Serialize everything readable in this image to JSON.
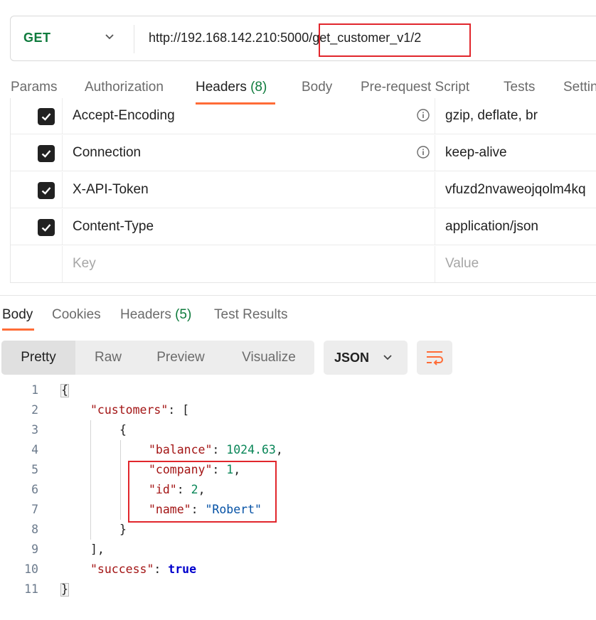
{
  "request": {
    "method": "GET",
    "url_host": "http://192.168.142.210:5000",
    "url_path": "/get_customer_v1/2"
  },
  "request_tabs": [
    {
      "label": "Params"
    },
    {
      "label": "Authorization"
    },
    {
      "label": "Headers",
      "count": "(8)",
      "active": true
    },
    {
      "label": "Body"
    },
    {
      "label": "Pre-request Script"
    },
    {
      "label": "Tests"
    },
    {
      "label": "Settin"
    }
  ],
  "headers": [
    {
      "key": "Accept-Encoding",
      "value": "gzip, deflate, br",
      "checked": true,
      "info": true
    },
    {
      "key": "Connection",
      "value": "keep-alive",
      "checked": true,
      "info": true
    },
    {
      "key": "X-API-Token",
      "value": "vfuzd2nvaweojqolm4kq",
      "checked": true,
      "info": false
    },
    {
      "key": "Content-Type",
      "value": "application/json",
      "checked": true,
      "info": false
    }
  ],
  "headers_placeholder": {
    "key": "Key",
    "value": "Value"
  },
  "response_tabs": [
    {
      "label": "Body",
      "active": true
    },
    {
      "label": "Cookies"
    },
    {
      "label": "Headers",
      "count": "(5)"
    },
    {
      "label": "Test Results"
    }
  ],
  "view_modes": [
    "Pretty",
    "Raw",
    "Preview",
    "Visualize"
  ],
  "active_view": "Pretty",
  "format": "JSON",
  "code_lines": [
    {
      "num": "1",
      "tokens": [
        {
          "t": "{",
          "c": "p"
        }
      ]
    },
    {
      "num": "2",
      "tokens": [
        {
          "t": "\"customers\"",
          "c": "k"
        },
        {
          "t": ": [",
          "c": "p"
        }
      ]
    },
    {
      "num": "3",
      "tokens": [
        {
          "t": "{",
          "c": "p"
        }
      ]
    },
    {
      "num": "4",
      "tokens": [
        {
          "t": "\"balance\"",
          "c": "k"
        },
        {
          "t": ": ",
          "c": "p"
        },
        {
          "t": "1024.63",
          "c": "n"
        },
        {
          "t": ",",
          "c": "p"
        }
      ]
    },
    {
      "num": "5",
      "tokens": [
        {
          "t": "\"company\"",
          "c": "k"
        },
        {
          "t": ": ",
          "c": "p"
        },
        {
          "t": "1",
          "c": "n"
        },
        {
          "t": ",",
          "c": "p"
        }
      ]
    },
    {
      "num": "6",
      "tokens": [
        {
          "t": "\"id\"",
          "c": "k"
        },
        {
          "t": ": ",
          "c": "p"
        },
        {
          "t": "2",
          "c": "n"
        },
        {
          "t": ",",
          "c": "p"
        }
      ]
    },
    {
      "num": "7",
      "tokens": [
        {
          "t": "\"name\"",
          "c": "k"
        },
        {
          "t": ": ",
          "c": "p"
        },
        {
          "t": "\"Robert\"",
          "c": "s"
        }
      ]
    },
    {
      "num": "8",
      "tokens": [
        {
          "t": "}",
          "c": "p"
        }
      ]
    },
    {
      "num": "9",
      "tokens": [
        {
          "t": "],",
          "c": "p"
        }
      ]
    },
    {
      "num": "10",
      "tokens": [
        {
          "t": "\"success\"",
          "c": "k"
        },
        {
          "t": ": ",
          "c": "p"
        },
        {
          "t": "true",
          "c": "b"
        }
      ]
    },
    {
      "num": "11",
      "tokens": [
        {
          "t": "}",
          "c": "p"
        }
      ]
    }
  ],
  "colors": {
    "accent": "#ff6c37",
    "method_get": "#0f7b3d",
    "highlight_box": "#e1262c"
  },
  "icons": {
    "method_dropdown": "chevron-down-icon",
    "header_info": "info-icon",
    "checkbox": "check-icon",
    "format_dropdown": "chevron-down-icon",
    "wrap": "text-wrap-icon"
  }
}
